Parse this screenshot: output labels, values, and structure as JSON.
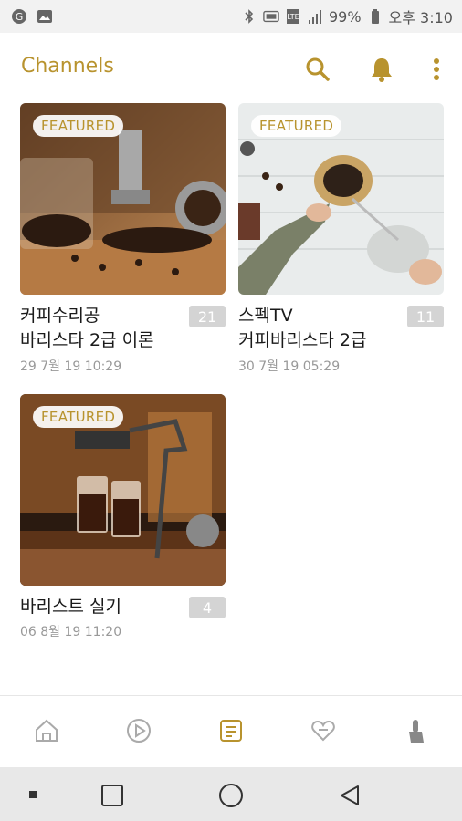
{
  "status_bar": {
    "battery": "99%",
    "time": "오후 3:10"
  },
  "app_bar": {
    "title": "Channels",
    "icons": [
      "search-icon",
      "bell-icon",
      "more-vert-icon"
    ]
  },
  "channels": [
    {
      "featured_label": "FEATURED",
      "title_line1": "커피수리공",
      "title_line2": "바리스타 2급 이론",
      "count": "21",
      "date": "29 7월 19 10:29"
    },
    {
      "featured_label": "FEATURED",
      "title_line1": "스펙TV",
      "title_line2": "커피바리스타 2급",
      "count": "11",
      "date": "30 7월 19 05:29"
    },
    {
      "featured_label": "FEATURED",
      "title_line1": "바리스트 실기",
      "title_line2": "",
      "count": "4",
      "date": "06 8월 19 11:20"
    }
  ],
  "bottom_nav": {
    "items": [
      "home-icon",
      "play-icon",
      "channels-icon",
      "heart-icon",
      "touch-icon"
    ],
    "active": "channels-icon"
  },
  "colors": {
    "accent": "#b8932e",
    "badge": "#d4d4d4",
    "date": "#999999"
  }
}
